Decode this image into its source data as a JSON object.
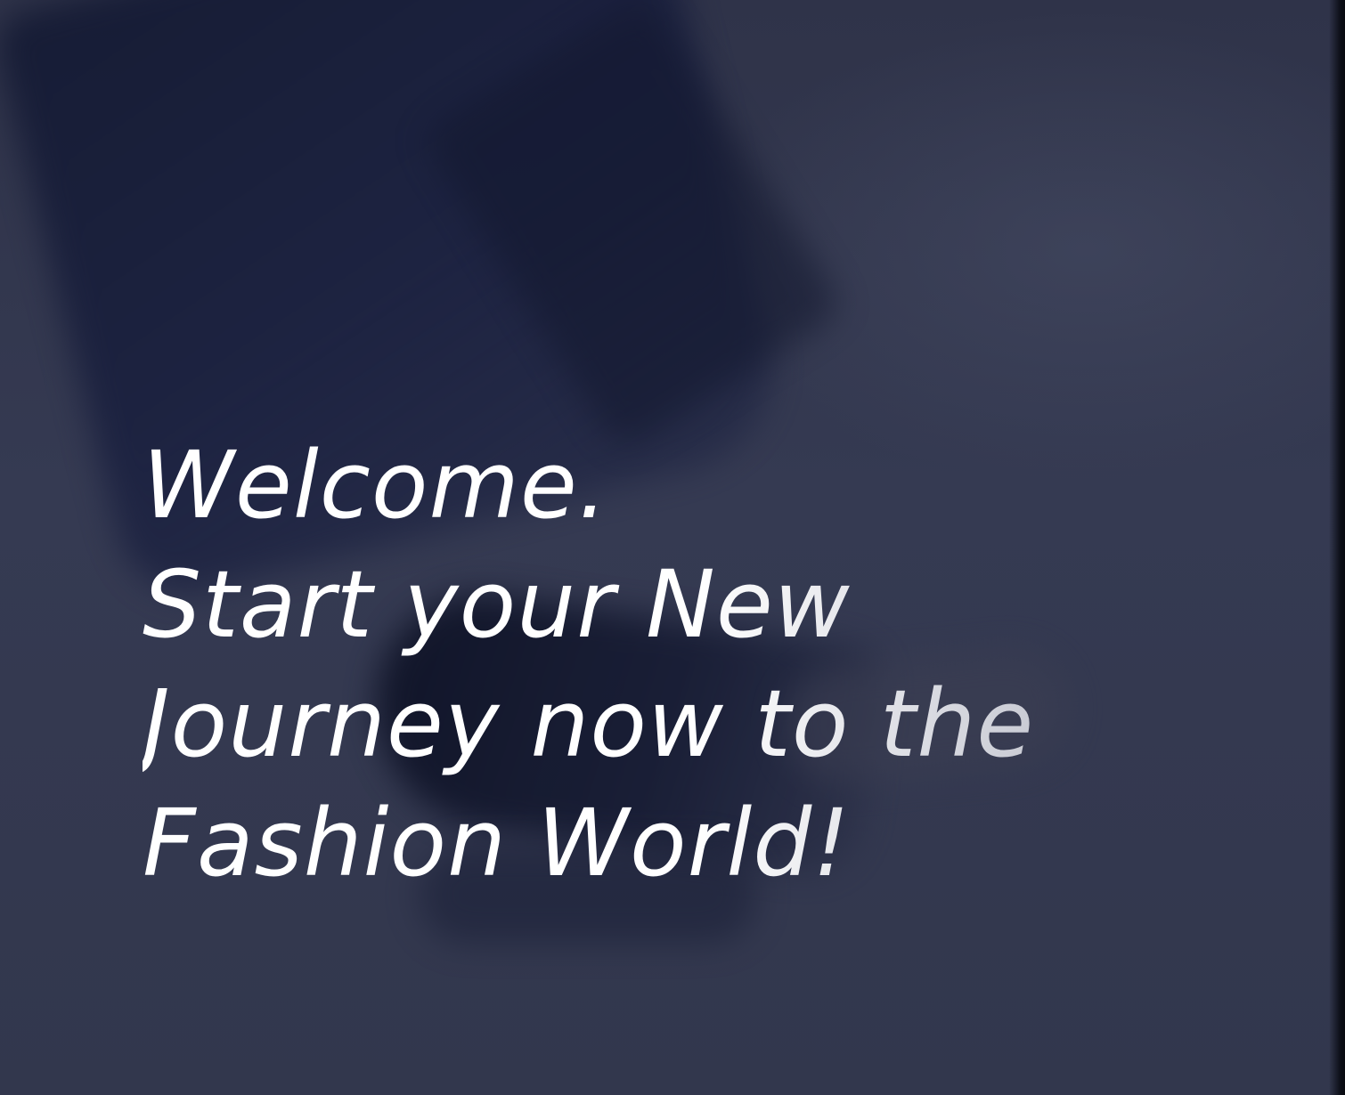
{
  "hero": {
    "headline_lines": [
      "Welcome.",
      "Start your New",
      "Journey now to the",
      "Fashion World!"
    ]
  },
  "colors": {
    "background": "#2f344a",
    "text": "#ffffff"
  }
}
